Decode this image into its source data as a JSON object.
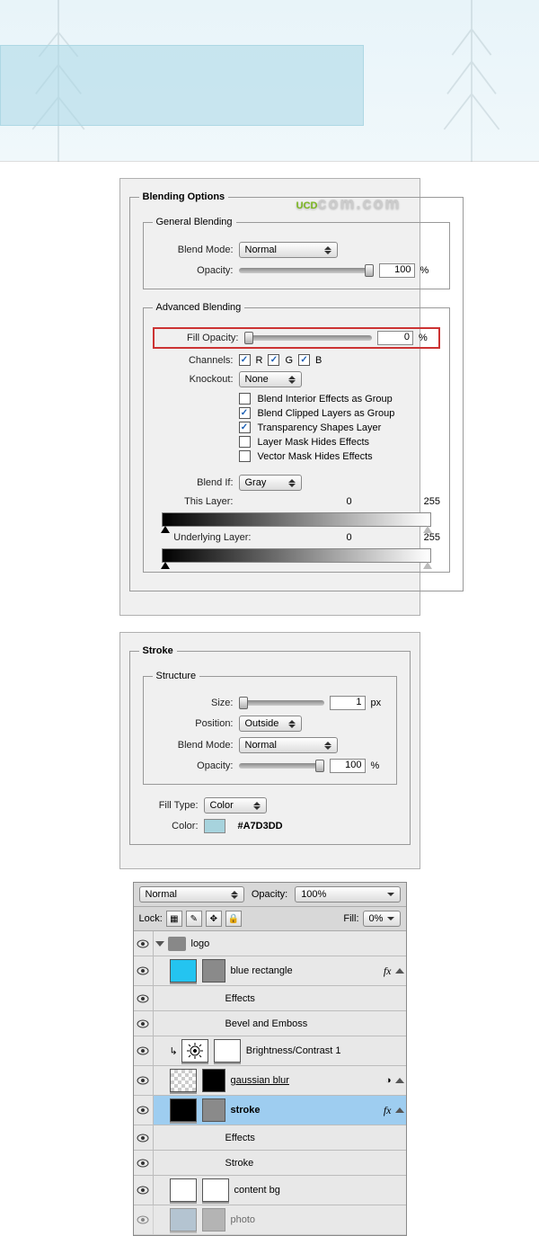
{
  "header_image": {
    "watermark_brand": "UCD",
    "watermark_suffix": "com.com"
  },
  "blending_options": {
    "title": "Blending Options",
    "general": {
      "legend": "General Blending",
      "blend_mode_label": "Blend Mode:",
      "blend_mode_value": "Normal",
      "opacity_label": "Opacity:",
      "opacity_value": "100",
      "opacity_suffix": "%"
    },
    "advanced": {
      "legend": "Advanced Blending",
      "fill_opacity_label": "Fill Opacity:",
      "fill_opacity_value": "0",
      "fill_opacity_suffix": "%",
      "channels_label": "Channels:",
      "channel_r": "R",
      "channel_g": "G",
      "channel_b": "B",
      "knockout_label": "Knockout:",
      "knockout_value": "None",
      "opt_blend_interior": {
        "label": "Blend Interior Effects as Group",
        "checked": false
      },
      "opt_blend_clipped": {
        "label": "Blend Clipped Layers as Group",
        "checked": true
      },
      "opt_transparency": {
        "label": "Transparency Shapes Layer",
        "checked": true
      },
      "opt_layer_mask": {
        "label": "Layer Mask Hides Effects",
        "checked": false
      },
      "opt_vector_mask": {
        "label": "Vector Mask Hides Effects",
        "checked": false
      },
      "blend_if_label": "Blend If:",
      "blend_if_value": "Gray",
      "this_layer_label": "This Layer:",
      "this_layer_low": "0",
      "this_layer_high": "255",
      "underlying_label": "Underlying Layer:",
      "underlying_low": "0",
      "underlying_high": "255"
    }
  },
  "stroke": {
    "title": "Stroke",
    "structure_legend": "Structure",
    "size_label": "Size:",
    "size_value": "1",
    "size_suffix": "px",
    "position_label": "Position:",
    "position_value": "Outside",
    "blend_mode_label": "Blend Mode:",
    "blend_mode_value": "Normal",
    "opacity_label": "Opacity:",
    "opacity_value": "100",
    "opacity_suffix": "%",
    "fill_type_label": "Fill Type:",
    "fill_type_value": "Color",
    "color_label": "Color:",
    "color_hex": "#A7D3DD"
  },
  "layers_panel": {
    "blend_mode": "Normal",
    "opacity_label": "Opacity:",
    "opacity_value": "100%",
    "lock_label": "Lock:",
    "fill_label": "Fill:",
    "fill_value": "0%",
    "layers": [
      {
        "type": "group",
        "name": "logo"
      },
      {
        "type": "layer",
        "name": "blue rectangle",
        "thumb": "#24c4f0",
        "has_mask": true,
        "fx": true,
        "effects_label": "Effects",
        "effects": [
          "Bevel and Emboss"
        ]
      },
      {
        "type": "adjustment",
        "name": "Brightness/Contrast 1",
        "has_mask": true
      },
      {
        "type": "layer",
        "name": "gaussian blur",
        "thumb": "checker",
        "has_mask": true,
        "mask_black": true,
        "smart": true,
        "underline": true
      },
      {
        "type": "layer",
        "name": "stroke",
        "thumb": "#000",
        "has_mask": true,
        "selected": true,
        "fx": true,
        "effects_label": "Effects",
        "effects": [
          "Stroke"
        ]
      },
      {
        "type": "layer",
        "name": "content bg",
        "thumb": "#fff",
        "has_mask": true
      },
      {
        "type": "layer",
        "name": "photo",
        "thumb": "#8aa8c0",
        "has_mask": true,
        "dim": true
      }
    ]
  }
}
